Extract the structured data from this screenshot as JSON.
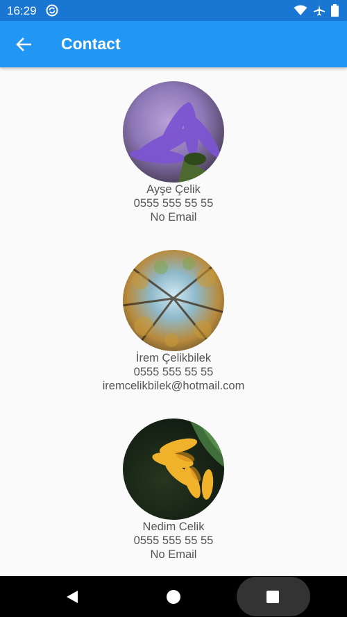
{
  "status_bar": {
    "time": "16:29",
    "icons": [
      "sync-icon",
      "wifi-icon",
      "airplane-mode-icon",
      "battery-icon"
    ]
  },
  "app_bar": {
    "title": "Contact",
    "back_icon": "arrow-back-icon",
    "color": "#2196f3"
  },
  "contacts": [
    {
      "name": "Ayşe Çelik",
      "phone": "0555 555 55 55",
      "email": "No Email",
      "avatar": "purple-flower-photo"
    },
    {
      "name": "İrem Çelikbilek",
      "phone": "0555 555 55 55",
      "email": "iremcelikbilek@hotmail.com",
      "avatar": "forest-canopy-photo"
    },
    {
      "name": "Nedim Celik",
      "phone": "0555 555 55 55",
      "email": "No Email",
      "avatar": "sunflower-photo"
    }
  ],
  "nav_bar": {
    "icons": [
      "nav-back-icon",
      "nav-home-icon",
      "nav-recents-icon"
    ]
  }
}
